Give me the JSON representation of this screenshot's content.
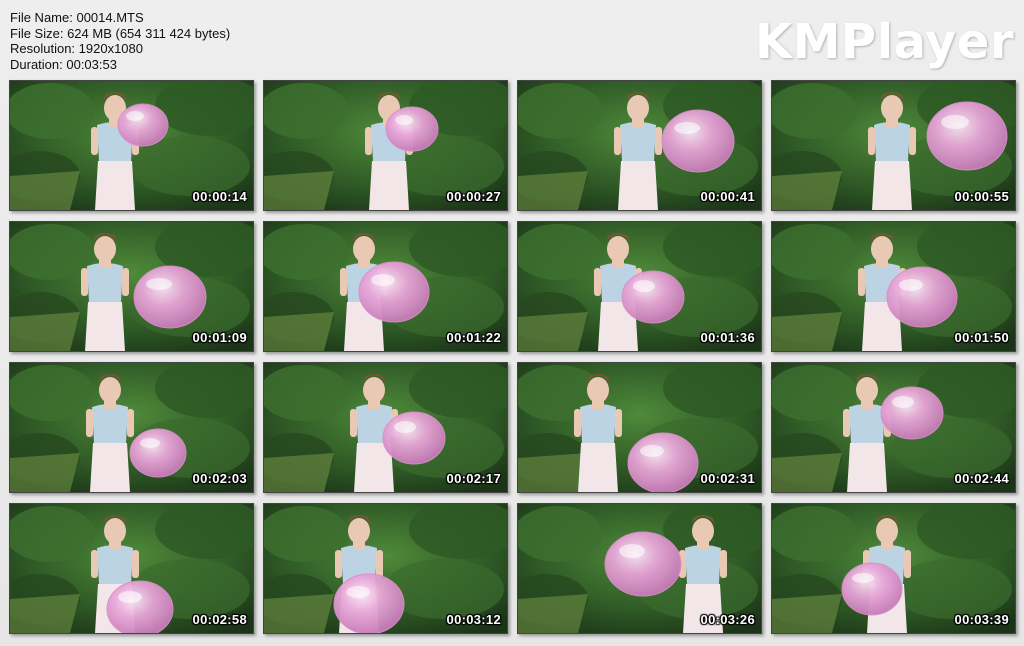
{
  "file_info": {
    "name_line": "File Name: 00014.MTS",
    "size_line": "File Size: 624 MB (654 311 424 bytes)",
    "resolution_line": "Resolution: 1920x1080",
    "duration_line": "Duration: 00:03:53"
  },
  "logo": {
    "text": "KMPlayer"
  },
  "colors": {
    "background": "#e8e8e8",
    "foliage_dark": "#1f3d1a",
    "foliage_light": "#4f8a3a",
    "grass": "#6e8f44",
    "balloon": "#e8a6d8",
    "timestamp": "#ffffff"
  },
  "thumbnails": [
    {
      "time": "00:00:14",
      "balloon_fill": 0.25
    },
    {
      "time": "00:00:27",
      "balloon_fill": 0.3
    },
    {
      "time": "00:00:41",
      "balloon_fill": 0.6
    },
    {
      "time": "00:00:55",
      "balloon_fill": 0.7
    },
    {
      "time": "00:01:09",
      "balloon_fill": 0.6
    },
    {
      "time": "00:01:22",
      "balloon_fill": 0.55
    },
    {
      "time": "00:01:36",
      "balloon_fill": 0.45
    },
    {
      "time": "00:01:50",
      "balloon_fill": 0.55
    },
    {
      "time": "00:02:03",
      "balloon_fill": 0.35
    },
    {
      "time": "00:02:17",
      "balloon_fill": 0.45
    },
    {
      "time": "00:02:31",
      "balloon_fill": 0.55
    },
    {
      "time": "00:02:44",
      "balloon_fill": 0.45
    },
    {
      "time": "00:02:58",
      "balloon_fill": 0.5
    },
    {
      "time": "00:03:12",
      "balloon_fill": 0.55
    },
    {
      "time": "00:03:26",
      "balloon_fill": 0.65
    },
    {
      "time": "00:03:39",
      "balloon_fill": 0.4
    }
  ]
}
